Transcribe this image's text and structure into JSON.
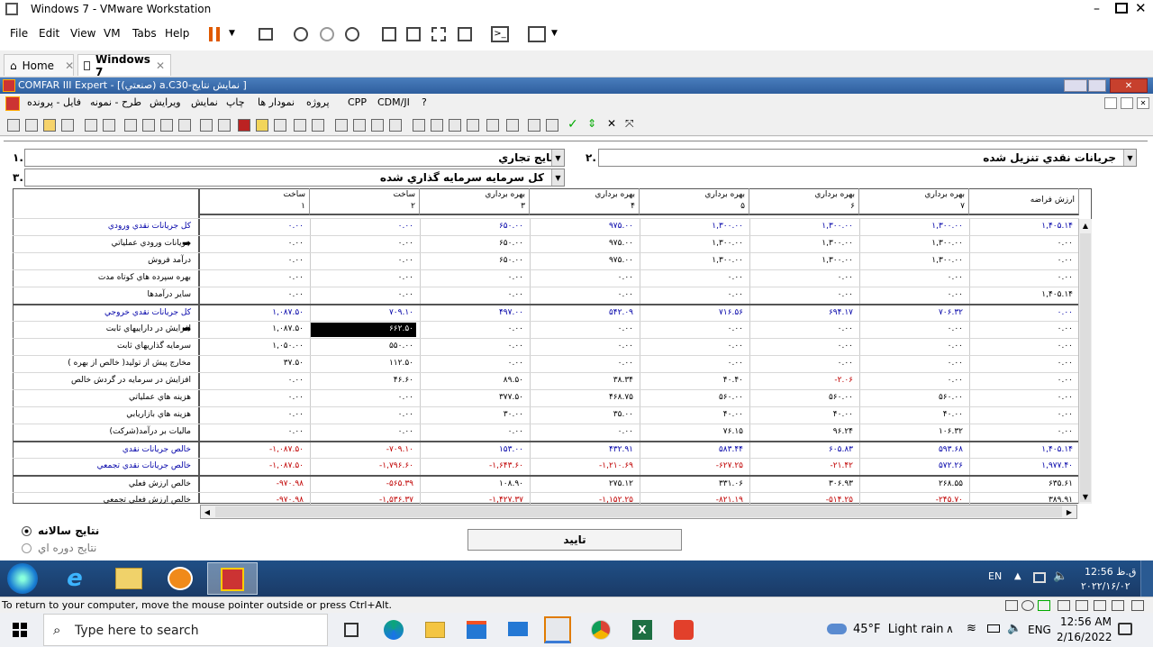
{
  "vmware": {
    "title": "Windows 7 - VMware Workstation",
    "menu": [
      "File",
      "Edit",
      "View",
      "VM",
      "Tabs",
      "Help"
    ],
    "tabs": [
      {
        "label": "Home"
      },
      {
        "label": "Windows 7"
      }
    ],
    "status_text": "To return to your computer, move the mouse pointer outside or press Ctrl+Alt."
  },
  "comfar": {
    "title": "COMFAR III Expert - [(صنعتي) a.C30-نمايش نتايج ]",
    "menu": [
      "فايل - پرونده",
      "طرح - نمونه",
      "ويرايش",
      "نمايش",
      "چاپ",
      "نمودار ها",
      "پروژه",
      "CPP",
      "CDM/JI",
      "?"
    ],
    "combo1_num": "۱.",
    "combo1_value": "نتايج تجاري",
    "combo2_num": "۲.",
    "combo2_value": "جريانات نقدي تنزيل شده",
    "combo3_num": "۳.",
    "combo3_value": "كل سرمايه سرمايه گذاري شده",
    "headers": [
      {
        "top": "ساخت",
        "bottom": "۱"
      },
      {
        "top": "ساخت",
        "bottom": "۲"
      },
      {
        "top": "بهره برداري",
        "bottom": "۳"
      },
      {
        "top": "بهره برداري",
        "bottom": "۴"
      },
      {
        "top": "بهره برداري",
        "bottom": "۵"
      },
      {
        "top": "بهره برداري",
        "bottom": "۶"
      },
      {
        "top": "بهره برداري",
        "bottom": "۷"
      },
      {
        "top": "ارزش فراضه",
        "bottom": ""
      }
    ],
    "rows": [
      {
        "label": "كل جريانات نقدي ورودي",
        "color": "blue",
        "values": [
          "۰.۰۰",
          "۰.۰۰",
          "۶۵۰.۰۰",
          "۹۷۵.۰۰",
          "۱,۳۰۰.۰۰",
          "۱,۳۰۰.۰۰",
          "۱,۳۰۰.۰۰",
          "۱,۴۰۵.۱۴"
        ]
      },
      {
        "label": "جريانات ورودي عملياتي",
        "color": "",
        "values": [
          "۰.۰۰",
          "۰.۰۰",
          "۶۵۰.۰۰",
          "۹۷۵.۰۰",
          "۱,۳۰۰.۰۰",
          "۱,۳۰۰.۰۰",
          "۱,۳۰۰.۰۰",
          "۰.۰۰"
        ]
      },
      {
        "label": "درآمد فروش",
        "color": "",
        "values": [
          "۰.۰۰",
          "۰.۰۰",
          "۶۵۰.۰۰",
          "۹۷۵.۰۰",
          "۱,۳۰۰.۰۰",
          "۱,۳۰۰.۰۰",
          "۱,۳۰۰.۰۰",
          "۰.۰۰"
        ]
      },
      {
        "label": "بهره سپرده هاي كوتاه مدت",
        "color": "",
        "values": [
          "۰.۰۰",
          "۰.۰۰",
          "۰.۰۰",
          "۰.۰۰",
          "۰.۰۰",
          "۰.۰۰",
          "۰.۰۰",
          "۰.۰۰"
        ]
      },
      {
        "label": "ساير درآمدها",
        "color": "",
        "values": [
          "۰.۰۰",
          "۰.۰۰",
          "۰.۰۰",
          "۰.۰۰",
          "۰.۰۰",
          "۰.۰۰",
          "۰.۰۰",
          "۱,۴۰۵.۱۴"
        ]
      },
      {
        "label": "كل جريانات نقدي خروجي",
        "color": "blue",
        "values": [
          "۱,۰۸۷.۵۰",
          "۷۰۹.۱۰",
          "۴۹۷.۰۰",
          "۵۴۲.۰۹",
          "۷۱۶.۵۶",
          "۶۹۴.۱۷",
          "۷۰۶.۳۲",
          "۰.۰۰"
        ]
      },
      {
        "label": "افزايش در داراييهاي ثابت",
        "color": "",
        "values": [
          "۱,۰۸۷.۵۰",
          "۶۶۲.۵۰",
          "۰.۰۰",
          "۰.۰۰",
          "۰.۰۰",
          "۰.۰۰",
          "۰.۰۰",
          "۰.۰۰"
        ]
      },
      {
        "label": "سرمايه گذاريهاي ثابت",
        "color": "",
        "values": [
          "۱,۰۵۰.۰۰",
          "۵۵۰.۰۰",
          "۰.۰۰",
          "۰.۰۰",
          "۰.۰۰",
          "۰.۰۰",
          "۰.۰۰",
          "۰.۰۰"
        ]
      },
      {
        "label": "مخارج پيش از توليد( خالص از بهره )",
        "color": "",
        "values": [
          "۳۷.۵۰",
          "۱۱۲.۵۰",
          "۰.۰۰",
          "۰.۰۰",
          "۰.۰۰",
          "۰.۰۰",
          "۰.۰۰",
          "۰.۰۰"
        ]
      },
      {
        "label": "افزايش در سرمايه در گردش خالص",
        "color": "",
        "values": [
          "۰.۰۰",
          "۴۶.۶۰",
          "۸۹.۵۰",
          "۳۸.۳۴",
          "۴۰.۴۰",
          "-۲.۰۶",
          "۰.۰۰",
          "۰.۰۰"
        ]
      },
      {
        "label": "هزينه هاي عملياتي",
        "color": "",
        "values": [
          "۰.۰۰",
          "۰.۰۰",
          "۳۷۷.۵۰",
          "۴۶۸.۷۵",
          "۵۶۰.۰۰",
          "۵۶۰.۰۰",
          "۵۶۰.۰۰",
          "۰.۰۰"
        ]
      },
      {
        "label": "هزينه هاي بازاريابي",
        "color": "",
        "values": [
          "۰.۰۰",
          "۰.۰۰",
          "۳۰.۰۰",
          "۳۵.۰۰",
          "۴۰.۰۰",
          "۴۰.۰۰",
          "۴۰.۰۰",
          "۰.۰۰"
        ]
      },
      {
        "label": "ماليات بر درآمد(شركت)",
        "color": "",
        "values": [
          "۰.۰۰",
          "۰.۰۰",
          "۰.۰۰",
          "۰.۰۰",
          "۷۶.۱۵",
          "۹۶.۲۴",
          "۱۰۶.۳۲",
          "۰.۰۰"
        ]
      },
      {
        "label": "خالص جريانات نقدي",
        "color": "blue",
        "values": [
          "-۱,۰۸۷.۵۰",
          "-۷۰۹.۱۰",
          "۱۵۳.۰۰",
          "۴۳۲.۹۱",
          "۵۸۳.۴۴",
          "۶۰۵.۸۳",
          "۵۹۳.۶۸",
          "۱,۴۰۵.۱۴"
        ]
      },
      {
        "label": "خالص جريانات نقدي تجمعي",
        "color": "blue",
        "values": [
          "-۱,۰۸۷.۵۰",
          "-۱,۷۹۶.۶۰",
          "-۱,۶۴۳.۶۰",
          "-۱,۲۱۰.۶۹",
          "-۶۲۷.۲۵",
          "-۲۱.۴۲",
          "۵۷۲.۲۶",
          "۱,۹۷۷.۴۰"
        ]
      },
      {
        "label": "خالص ارزش فعلي",
        "color": "",
        "values": [
          "-۹۷۰.۹۸",
          "-۵۶۵.۳۹",
          "۱۰۸.۹۰",
          "۲۷۵.۱۲",
          "۳۳۱.۰۶",
          "۳۰۶.۹۳",
          "۲۶۸.۵۵",
          "۶۳۵.۶۱"
        ]
      },
      {
        "label": "خالص ارزش فعلي تجمعي",
        "color": "",
        "values": [
          "-۹۷۰.۹۸",
          "-۱,۵۳۶.۳۷",
          "-۱,۴۲۷.۳۷",
          "-۱,۱۵۲.۲۵",
          "-۸۲۱.۱۹",
          "-۵۱۴.۲۵",
          "-۲۴۵.۷۰",
          "۳۸۹.۹۱"
        ]
      }
    ],
    "option1": "نتايج سالانه",
    "option2": "نتايج دوره اي",
    "confirm": "تاييد"
  },
  "win7": {
    "lang": "EN",
    "time": "12:56 ق.ظ",
    "date": "۲۰۲۲/۱۶/۰۲"
  },
  "win10": {
    "search_placeholder": "Type here to search",
    "weather": "45°F  Light rain",
    "lang": "ENG",
    "time": "12:56 AM",
    "date": "2/16/2022"
  },
  "colors": {
    "blue_text": "#0000a8",
    "red_text": "#c00000",
    "accent": "#2e5e9e"
  }
}
